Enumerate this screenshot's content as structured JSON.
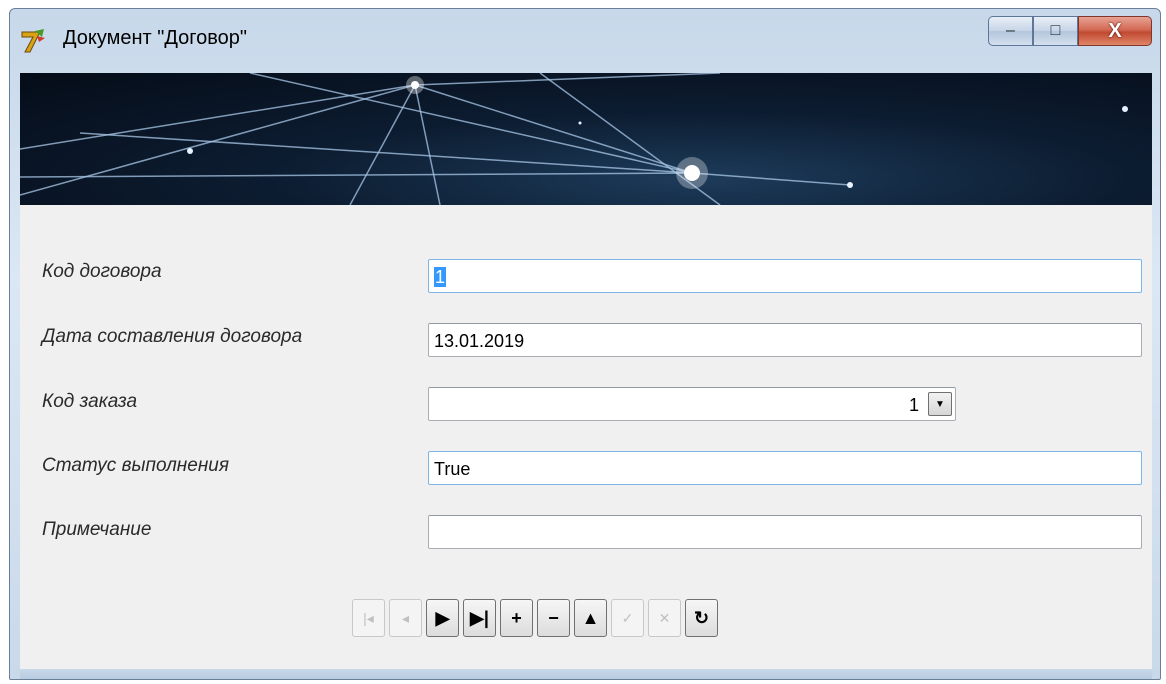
{
  "window": {
    "title": "Документ \"Договор\"",
    "controls": {
      "minimize": "–",
      "maximize": "□",
      "close": "X"
    }
  },
  "form": {
    "fields": [
      {
        "label": "Код договора",
        "value_selected": "1"
      },
      {
        "label": "Дата составления договора",
        "value": "13.01.2019"
      },
      {
        "label": "Код заказа",
        "value": "1"
      },
      {
        "label": "Статус выполнения",
        "value": "True"
      },
      {
        "label": "Примечание",
        "value": ""
      }
    ]
  },
  "navigator": {
    "buttons": [
      {
        "name": "first",
        "glyph": "|◂",
        "enabled": false
      },
      {
        "name": "prior",
        "glyph": "◂",
        "enabled": false
      },
      {
        "name": "next",
        "glyph": "▶",
        "enabled": true
      },
      {
        "name": "last",
        "glyph": "▶|",
        "enabled": true
      },
      {
        "name": "insert",
        "glyph": "+",
        "enabled": true
      },
      {
        "name": "delete",
        "glyph": "−",
        "enabled": true
      },
      {
        "name": "edit",
        "glyph": "▲",
        "enabled": true
      },
      {
        "name": "post",
        "glyph": "✓",
        "enabled": false
      },
      {
        "name": "cancel",
        "glyph": "✕",
        "enabled": false
      },
      {
        "name": "refresh",
        "glyph": "↻",
        "enabled": true
      }
    ]
  },
  "colors": {
    "selection": "#3399ff",
    "focus_border": "#7eb4ea"
  }
}
